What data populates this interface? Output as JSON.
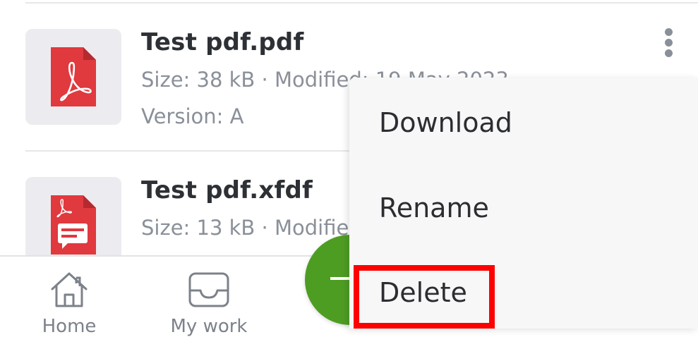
{
  "files": [
    {
      "name": "Test pdf.pdf",
      "meta": "Size: 38 kB · Modified: 19 May 2023",
      "version": "Version: A",
      "icon": "pdf-file-icon"
    },
    {
      "name": "Test pdf.xfdf",
      "meta": "Size: 13 kB · Modified",
      "icon": "xfdf-file-icon"
    }
  ],
  "menu": {
    "items": [
      {
        "label": "Download"
      },
      {
        "label": "Rename"
      },
      {
        "label": "Delete"
      }
    ],
    "highlighted": "Delete"
  },
  "bottom_nav": {
    "items": [
      {
        "label": "Home",
        "icon": "home-icon"
      },
      {
        "label": "My work",
        "icon": "inbox-tray-icon"
      }
    ]
  },
  "fab": {
    "icon": "plus-icon"
  },
  "colors": {
    "pdf_red": "#e0393e",
    "fab_green": "#4e9d23",
    "highlight": "#ff0000",
    "meta_gray": "#8a9099"
  }
}
